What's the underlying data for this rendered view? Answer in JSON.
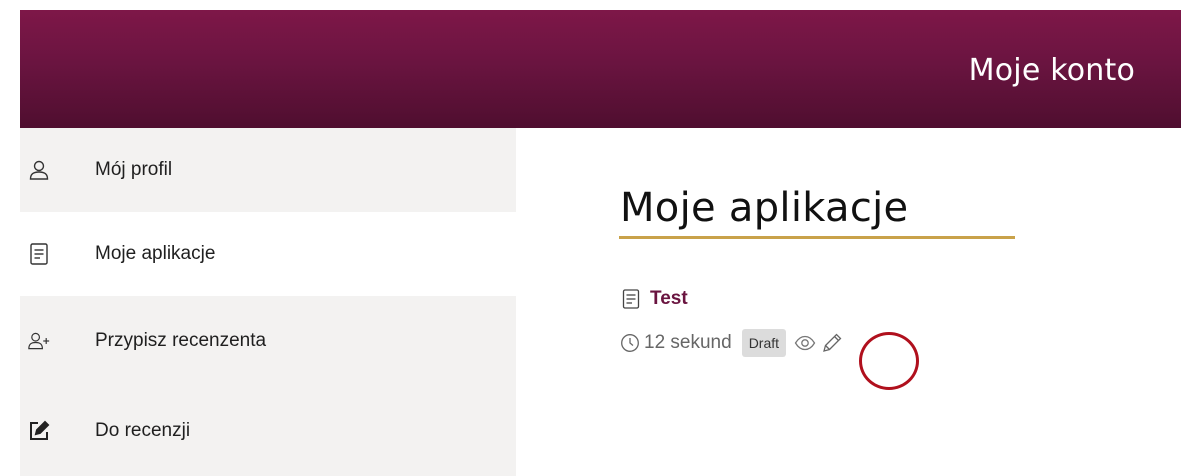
{
  "header": {
    "title": "Moje konto"
  },
  "sidebar": {
    "items": [
      {
        "label": "Mój profil",
        "icon": "user-icon"
      },
      {
        "label": "Moje aplikacje",
        "icon": "document-icon",
        "active": true
      },
      {
        "label": "Przypisz recenzenta",
        "icon": "add-user-icon"
      },
      {
        "label": "Do recenzji",
        "icon": "edit-square-icon"
      }
    ]
  },
  "main": {
    "title": "Moje aplikacje",
    "applications": [
      {
        "name": "Test",
        "time": "12 sekund",
        "status": "Draft"
      }
    ]
  },
  "colors": {
    "brand": "#6a1440",
    "accent": "#c9a24a",
    "highlight": "#b0101d"
  }
}
